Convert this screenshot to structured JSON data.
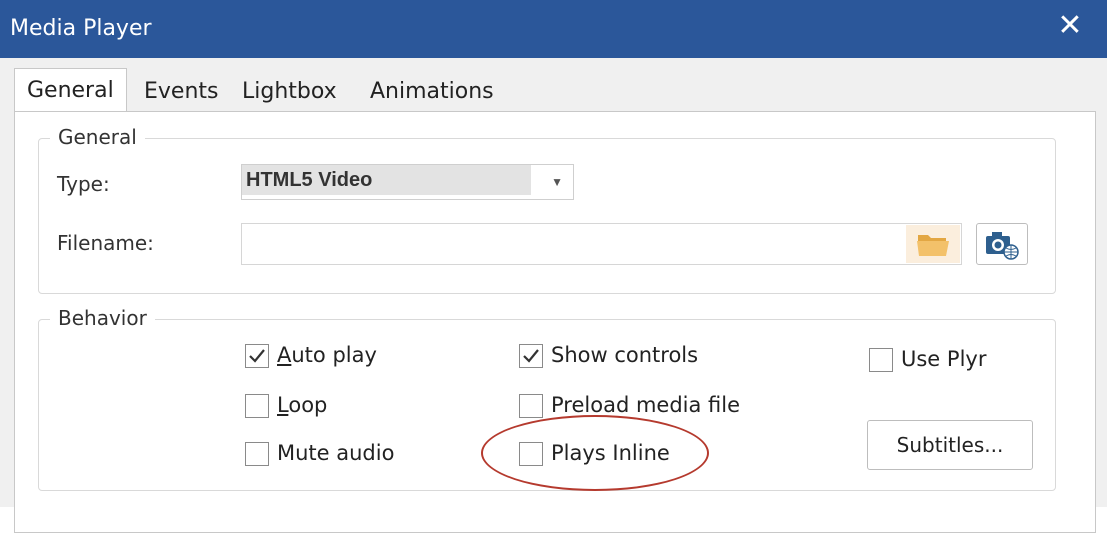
{
  "window": {
    "title": "Media Player",
    "close_glyph": "✕"
  },
  "tabs": [
    {
      "label": "General",
      "active": true
    },
    {
      "label": "Events",
      "active": false
    },
    {
      "label": "Lightbox",
      "active": false
    },
    {
      "label": "Animations",
      "active": false
    }
  ],
  "general": {
    "legend": "General",
    "type_label": "Type:",
    "type_value": "HTML5 Video",
    "filename_label": "Filename:",
    "filename_value": "",
    "icons": {
      "browse": "folder-icon",
      "online": "camera-globe-icon"
    }
  },
  "behavior": {
    "legend": "Behavior",
    "checkboxes": [
      {
        "label": "Auto play",
        "mnemonic": "A",
        "rest": "uto play",
        "checked": true
      },
      {
        "label": "Loop",
        "mnemonic": "L",
        "rest": "oop",
        "checked": false
      },
      {
        "label": "Mute audio",
        "checked": false
      },
      {
        "label": "Show controls",
        "checked": true
      },
      {
        "label": "Preload media file",
        "checked": false
      },
      {
        "label": "Plays Inline",
        "checked": false
      },
      {
        "label": "Use Plyr",
        "checked": false
      }
    ],
    "subtitles_button": "Subtitles..."
  },
  "colors": {
    "titlebar": "#2b579a",
    "annotation": "#b53a2e",
    "folder": "#f0b85a"
  }
}
